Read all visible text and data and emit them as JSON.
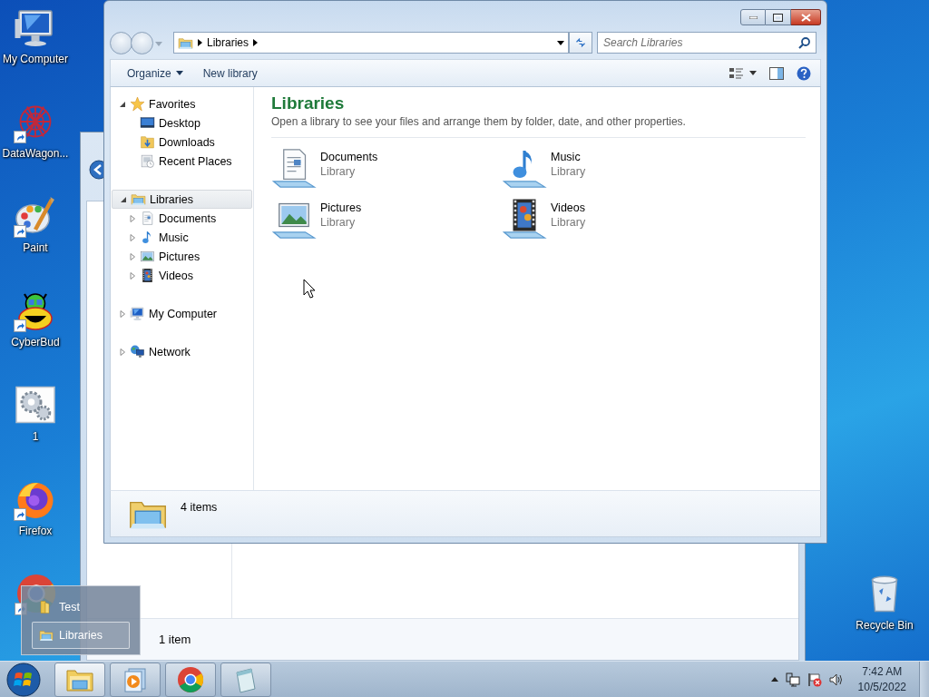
{
  "desktop_icons": [
    {
      "label": "My Computer",
      "kind": "computer",
      "shortcut": false
    },
    {
      "label": "DataWagon...",
      "kind": "datawagon",
      "shortcut": true
    },
    {
      "label": "Paint",
      "kind": "paint",
      "shortcut": true
    },
    {
      "label": "CyberBud",
      "kind": "bug",
      "shortcut": true
    },
    {
      "label": "1",
      "kind": "gears",
      "shortcut": false
    },
    {
      "label": "Firefox",
      "kind": "firefox",
      "shortcut": true
    }
  ],
  "hidden_desktop_icon": {
    "kind": "chrome",
    "shortcut": true
  },
  "recycle_bin": {
    "label": "Recycle Bin",
    "kind": "recycle"
  },
  "background_window": {
    "status": "1 item"
  },
  "window": {
    "address": {
      "crumbs": [
        "Libraries"
      ]
    },
    "search": {
      "placeholder": "Search Libraries"
    },
    "commands": [
      {
        "label": "Organize",
        "dropdown": true
      },
      {
        "label": "New library",
        "dropdown": false
      }
    ],
    "navigation": [
      {
        "label": "Favorites",
        "kind": "star",
        "expanded": true,
        "selected": false,
        "children": [
          {
            "label": "Desktop",
            "kind": "desktop",
            "selected": false
          },
          {
            "label": "Downloads",
            "kind": "downloads",
            "selected": false
          },
          {
            "label": "Recent Places",
            "kind": "recent",
            "selected": false
          }
        ]
      },
      {
        "label": "Libraries",
        "kind": "library",
        "expanded": true,
        "selected": true,
        "children": [
          {
            "label": "Documents",
            "kind": "document",
            "expanded": false,
            "selected": false
          },
          {
            "label": "Music",
            "kind": "music",
            "expanded": false,
            "selected": false
          },
          {
            "label": "Pictures",
            "kind": "pictures",
            "expanded": false,
            "selected": false
          },
          {
            "label": "Videos",
            "kind": "videos",
            "expanded": false,
            "selected": false
          }
        ]
      },
      {
        "label": "My Computer",
        "kind": "computer",
        "expanded": false,
        "selected": false
      },
      {
        "label": "Network",
        "kind": "network",
        "expanded": false,
        "selected": false
      }
    ],
    "content": {
      "title": "Libraries",
      "description": "Open a library to see your files and arrange them by folder, date, and other properties.",
      "items": [
        {
          "name": "Documents",
          "type": "Library",
          "kind": "document"
        },
        {
          "name": "Music",
          "type": "Library",
          "kind": "music"
        },
        {
          "name": "Pictures",
          "type": "Library",
          "kind": "pictures"
        },
        {
          "name": "Videos",
          "type": "Library",
          "kind": "videos"
        }
      ]
    },
    "status": {
      "count": "4 items",
      "kind": "library"
    }
  },
  "jump_list": {
    "items": [
      {
        "label": "Test",
        "kind": "folder",
        "selected": false
      },
      {
        "label": "Libraries",
        "kind": "library",
        "selected": true
      }
    ]
  },
  "taskbar": {
    "buttons": [
      {
        "kind": "explorer",
        "selected": true
      },
      {
        "kind": "mediaplayer",
        "selected": false
      },
      {
        "kind": "chrome",
        "selected": false
      },
      {
        "kind": "notepad",
        "selected": false
      }
    ],
    "tray": [
      {
        "kind": "network"
      },
      {
        "kind": "flag"
      },
      {
        "kind": "speaker"
      }
    ],
    "clock": {
      "time": "7:42 AM",
      "date": "10/5/2022"
    }
  }
}
